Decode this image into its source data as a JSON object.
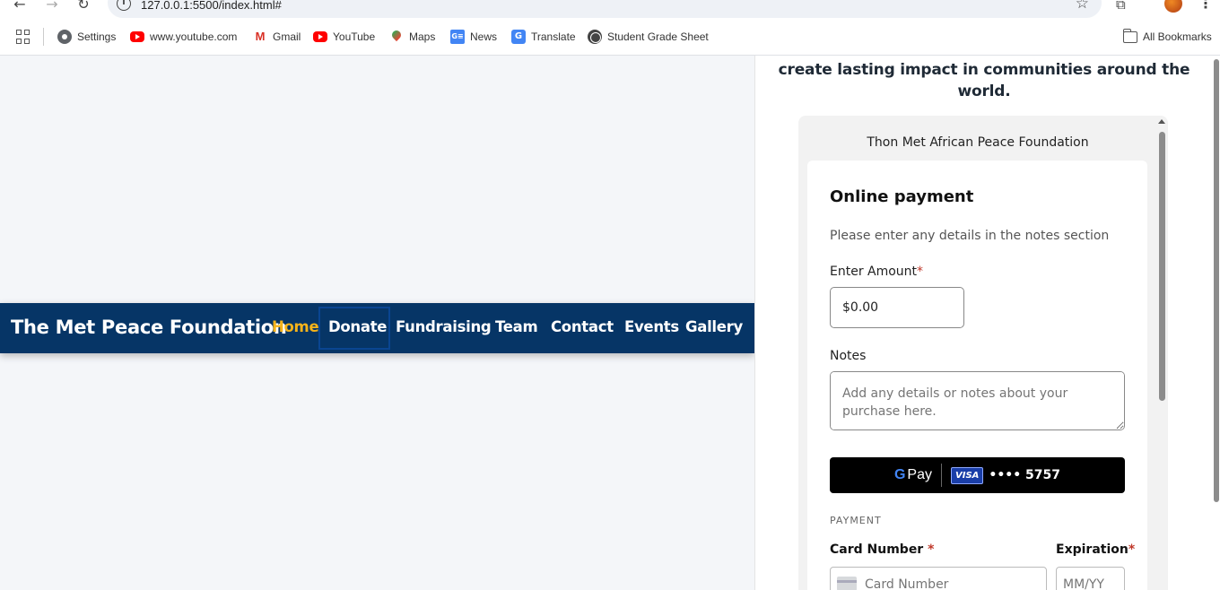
{
  "browser": {
    "url": "127.0.0.1:5500/index.html#",
    "bookmarks": [
      {
        "label": "Settings",
        "icon": "gear-icon"
      },
      {
        "label": "www.youtube.com",
        "icon": "youtube-icon"
      },
      {
        "label": "Gmail",
        "icon": "gmail-icon"
      },
      {
        "label": "YouTube",
        "icon": "youtube-icon"
      },
      {
        "label": "Maps",
        "icon": "maps-icon"
      },
      {
        "label": "News",
        "icon": "news-icon"
      },
      {
        "label": "Translate",
        "icon": "translate-icon"
      },
      {
        "label": "Student Grade Sheet",
        "icon": "globe-icon"
      }
    ],
    "all_bookmarks": "All Bookmarks"
  },
  "navbar": {
    "brand": "The Met Peace Foundation",
    "links": [
      "Home",
      "Donate",
      "Fundraising",
      "Team",
      "Contact",
      "Events",
      "Gallery"
    ],
    "active": "Home",
    "colors": {
      "background": "#063566",
      "active": "#f5b31a",
      "text": "#ffffff"
    }
  },
  "panel": {
    "intro": "create lasting impact in communities around the world.",
    "org_name": "Thon Met African Peace Foundation",
    "payment": {
      "title": "Online payment",
      "description": "Please enter any details in the notes section",
      "amount_label": "Enter Amount",
      "amount_value": "$0.00",
      "notes_label": "Notes",
      "notes_placeholder": "Add any details or notes about your purchase here.",
      "gpay": {
        "brand": "G",
        "pay": "Pay",
        "card_brand": "VISA",
        "card_last": "•••• 5757"
      },
      "section": "PAYMENT",
      "card_number_label": "Card Number",
      "card_number_placeholder": "Card Number",
      "expiration_label": "Expiration",
      "expiration_placeholder": "MM/YY",
      "required_mark": "*"
    }
  }
}
